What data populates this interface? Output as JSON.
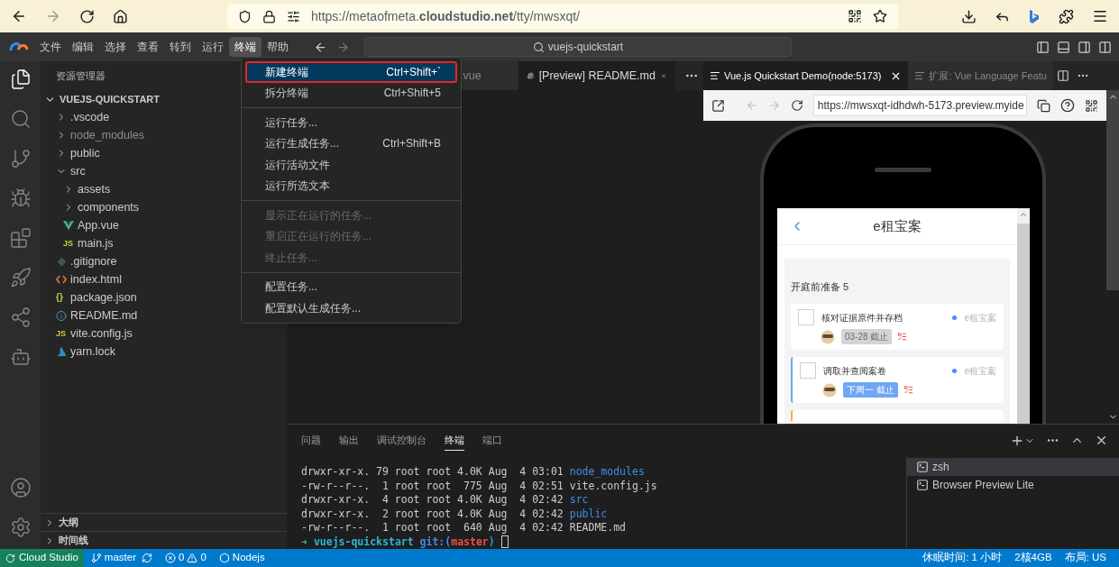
{
  "browser": {
    "url": "https://metaofmeta.**cloudstudio.net**/tty/mwsxqt/"
  },
  "menu_bar": [
    {
      "label": "文件",
      "selected": false
    },
    {
      "label": "编辑",
      "selected": false
    },
    {
      "label": "选择",
      "selected": false
    },
    {
      "label": "查看",
      "selected": false
    },
    {
      "label": "转到",
      "selected": false
    },
    {
      "label": "运行",
      "selected": false
    },
    {
      "label": "终端",
      "selected": true
    },
    {
      "label": "帮助",
      "selected": false
    }
  ],
  "command_center": "vuejs-quickstart",
  "terminal_menu": [
    [
      {
        "label": "新建终端",
        "shortcut": "Ctrl+Shift+`",
        "selected": true,
        "disabled": false
      },
      {
        "label": "拆分终端",
        "shortcut": "Ctrl+Shift+5",
        "selected": false,
        "disabled": false
      }
    ],
    [
      {
        "label": "运行任务...",
        "selected": false,
        "disabled": false
      },
      {
        "label": "运行生成任务...",
        "shortcut": "Ctrl+Shift+B",
        "selected": false,
        "disabled": false
      },
      {
        "label": "运行活动文件",
        "selected": false,
        "disabled": false
      },
      {
        "label": "运行所选文本",
        "selected": false,
        "disabled": false
      }
    ],
    [
      {
        "label": "显示正在运行的任务...",
        "selected": false,
        "disabled": true
      },
      {
        "label": "重启正在运行的任务...",
        "selected": false,
        "disabled": true
      },
      {
        "label": "终止任务...",
        "selected": false,
        "disabled": true
      }
    ],
    [
      {
        "label": "配置任务...",
        "selected": false,
        "disabled": false
      },
      {
        "label": "配置默认生成任务...",
        "selected": false,
        "disabled": false
      }
    ]
  ],
  "explorer": {
    "title": "资源管理器",
    "root": {
      "label": "VUEJS-QUICKSTART",
      "expanded": true,
      "children": [
        {
          "label": ".vscode",
          "kind": "folder",
          "expanded": false,
          "ignored": false
        },
        {
          "label": "node_modules",
          "kind": "folder",
          "expanded": false,
          "ignored": true
        },
        {
          "label": "public",
          "kind": "folder",
          "expanded": false,
          "ignored": false
        },
        {
          "label": "src",
          "kind": "folder",
          "expanded": true,
          "ignored": false,
          "children": [
            {
              "label": "assets",
              "kind": "folder",
              "expanded": false,
              "ignored": false
            },
            {
              "label": "components",
              "kind": "folder",
              "expanded": false,
              "ignored": false
            },
            {
              "label": "App.vue",
              "kind": "vue",
              "ignored": false
            },
            {
              "label": "main.js",
              "kind": "js",
              "glyph": "JS",
              "ignored": false
            }
          ]
        },
        {
          "label": ".gitignore",
          "kind": "git",
          "ignored": false
        },
        {
          "label": "index.html",
          "kind": "html",
          "ignored": false
        },
        {
          "label": "package.json",
          "kind": "json",
          "glyph": "{}",
          "ignored": false
        },
        {
          "label": "README.md",
          "kind": "info",
          "ignored": false
        },
        {
          "label": "vite.config.js",
          "kind": "js",
          "glyph": "JS",
          "ignored": false
        },
        {
          "label": "yarn.lock",
          "kind": "yarn",
          "ignored": false
        }
      ]
    }
  },
  "sections": [
    {
      "label": "大纲",
      "expanded": false
    },
    {
      "label": "时间线",
      "expanded": false
    }
  ],
  "editor_tabs": [
    {
      "label": ".vue",
      "selected": false
    },
    {
      "label": "[Preview] README.md",
      "selected": true
    }
  ],
  "preview_tabs": [
    {
      "label": "Vue.js Quickstart Demo(node:5173)",
      "selected": true
    },
    {
      "label": "扩展: Vue Language Featu",
      "selected": false
    }
  ],
  "preview_url": "https://mwsxqt-idhdwh-5173.preview.myide",
  "app": {
    "title": "e租宝案",
    "group_title": "开庭前准备 5",
    "tasks": [
      {
        "kind": "task",
        "title": "核对证据原件并存档",
        "project": "e租宝案",
        "due": "03-28 截止",
        "highlighted": false,
        "checked": false
      },
      {
        "kind": "task",
        "title": "调取并查阅案卷",
        "project": "e租宝案",
        "due": "下周一 截止",
        "highlighted": true,
        "checked": false,
        "color": "#6ea6f5"
      },
      {
        "kind": "peek",
        "color": "#f0b050"
      }
    ]
  },
  "panel_tabs": [
    {
      "label": "问题",
      "selected": false
    },
    {
      "label": "输出",
      "selected": false
    },
    {
      "label": "调试控制台",
      "selected": false
    },
    {
      "label": "终端",
      "selected": true
    },
    {
      "label": "端口",
      "selected": false
    }
  ],
  "terminal_lines": [
    {
      "text": "drwxr-xr-x. 79 root root 4.0K Aug  4 03:01 ",
      "name": "node_modules",
      "kind": "dir"
    },
    {
      "text": "-rw-r--r--.  1 root root  775 Aug  4 02:51 ",
      "name": "vite.config.js",
      "kind": "file"
    },
    {
      "text": "drwxr-xr-x.  4 root root 4.0K Aug  4 02:42 ",
      "name": "src",
      "kind": "dir"
    },
    {
      "text": "drwxr-xr-x.  2 root root 4.0K Aug  4 02:42 ",
      "name": "public",
      "kind": "dir"
    },
    {
      "text": "-rw-r--r--.  1 root root  640 Aug  4 02:42 ",
      "name": "README.md",
      "kind": "file"
    }
  ],
  "prompt": {
    "arrow": "➜",
    "dir": "vuejs-quickstart",
    "git": "git:(",
    "branch": "master",
    "close": ")"
  },
  "terminals": [
    {
      "label": "zsh",
      "selected": true
    },
    {
      "label": "Browser Preview Lite",
      "selected": false
    }
  ],
  "status_bar": {
    "remote": "Cloud Studio",
    "branch": "master",
    "errors": "0",
    "warnings": "0",
    "env": "Nodejs",
    "right": [
      "休眠时间: 1 小时",
      "2核4GB",
      "布局: US"
    ]
  }
}
